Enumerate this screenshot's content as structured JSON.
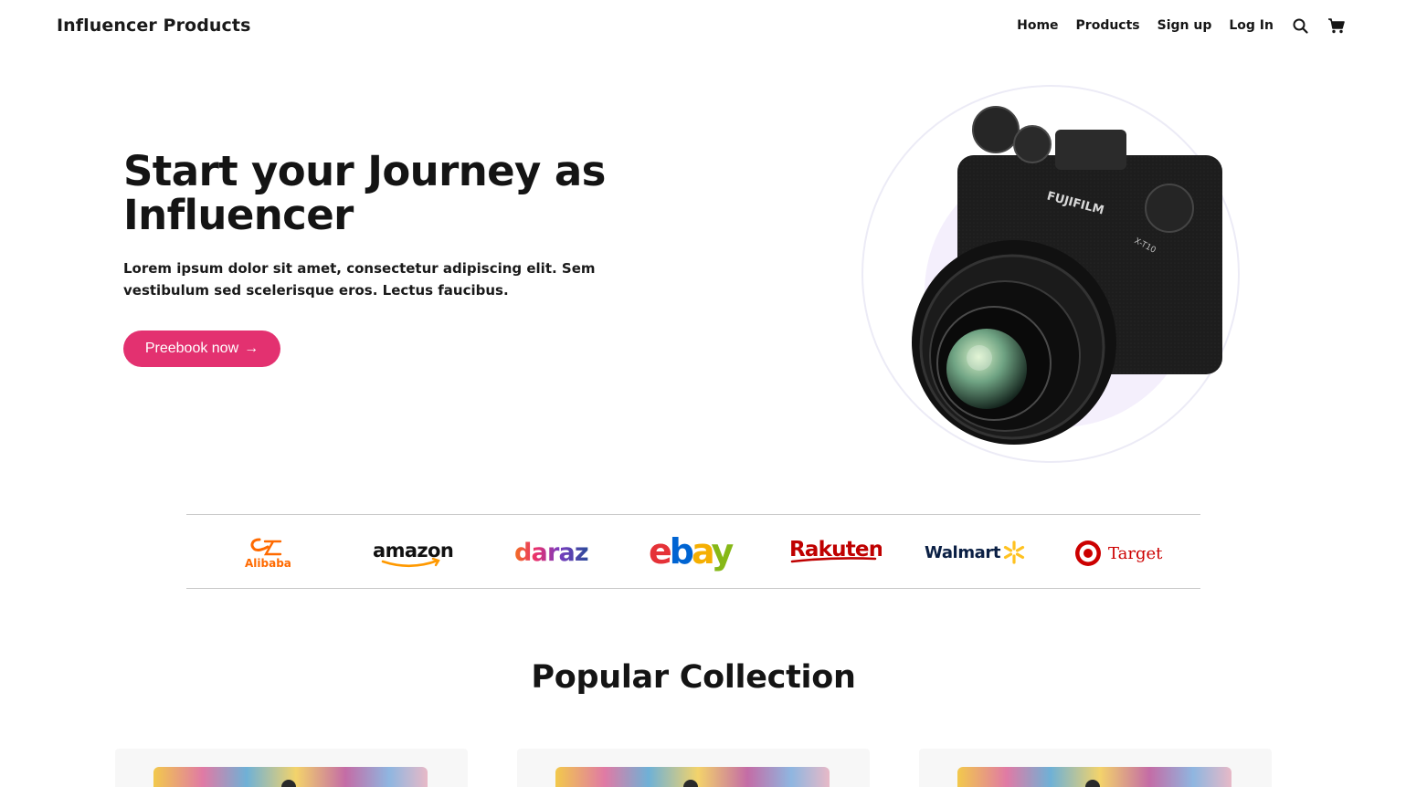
{
  "brand": "Influencer Products",
  "nav": {
    "items": [
      "Home",
      "Products",
      "Sign up",
      "Log In"
    ]
  },
  "icons": {
    "search": "search-icon",
    "cart": "cart-icon"
  },
  "hero": {
    "title": "Start your Journey as Influencer",
    "description": "Lorem ipsum dolor sit amet, consectetur adipiscing elit. Sem vestibulum sed scelerisque eros. Lectus faucibus.",
    "cta_label": "Preebook now",
    "cta_arrow": "→"
  },
  "partners": [
    "Alibaba",
    "amazon",
    "daraz",
    "ebay",
    "Rakuten",
    "Walmart",
    "Target"
  ],
  "camera_brand": "FUJIFILM",
  "camera_model": "X-T10",
  "section": {
    "title": "Popular Collection"
  },
  "colors": {
    "accent": "#e33170",
    "alibaba": "#ff6a00",
    "amazon_text": "#111111",
    "amazon_smile": "#ff9900",
    "rakuten": "#bf0000",
    "walmart_text": "#0a1f44",
    "walmart_spark": "#ffc220",
    "target": "#cc0000"
  }
}
